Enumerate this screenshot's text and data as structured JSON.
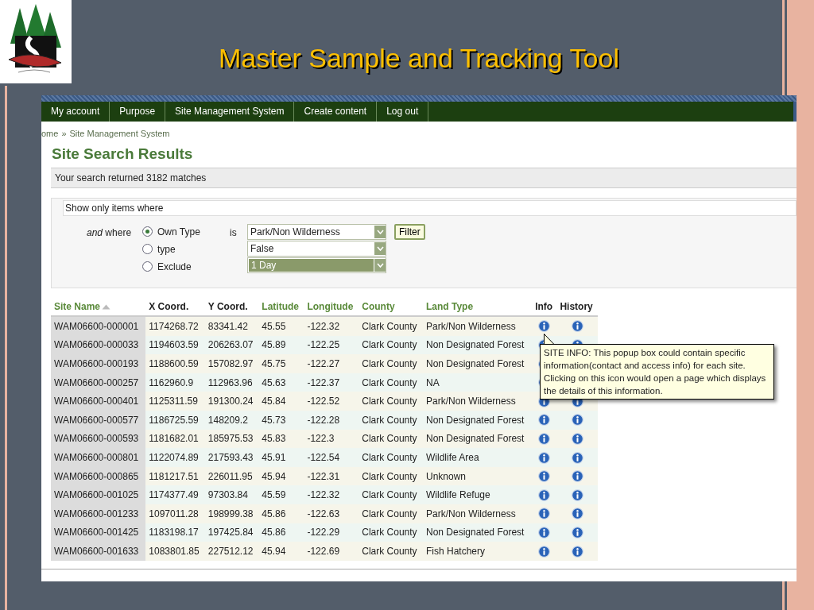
{
  "slide": {
    "title": "Master Sample and Tracking Tool"
  },
  "nav": [
    {
      "label": "My account"
    },
    {
      "label": "Purpose"
    },
    {
      "label": "Site Management System"
    },
    {
      "label": "Create content"
    },
    {
      "label": "Log out"
    }
  ],
  "breadcrumb": {
    "home": "ome",
    "separator": "»",
    "current": "Site Management System"
  },
  "page_title": "Site Search Results",
  "result_summary": "Your search returned 3182 matches",
  "filter": {
    "legend": "Show only items where",
    "lead_em": "and",
    "lead": "where",
    "is_label": "is",
    "button": "Filter",
    "options": [
      {
        "label": "Own Type",
        "selected": true
      },
      {
        "label": "type",
        "selected": false
      },
      {
        "label": "Exclude",
        "selected": false
      }
    ],
    "selects": [
      {
        "value": "Park/Non Wilderness",
        "highlighted": false
      },
      {
        "value": "False",
        "highlighted": false
      },
      {
        "value": "1 Day",
        "highlighted": true
      }
    ]
  },
  "table": {
    "columns": [
      {
        "label": "Site Name",
        "sortable": true,
        "sorted": true
      },
      {
        "label": "X Coord.",
        "sortable": false,
        "sorted": false
      },
      {
        "label": "Y Coord.",
        "sortable": false,
        "sorted": false
      },
      {
        "label": "Latitude",
        "sortable": true,
        "sorted": false
      },
      {
        "label": "Longitude",
        "sortable": true,
        "sorted": false
      },
      {
        "label": "County",
        "sortable": true,
        "sorted": false
      },
      {
        "label": "Land Type",
        "sortable": true,
        "sorted": false
      },
      {
        "label": "Info",
        "sortable": false,
        "sorted": false
      },
      {
        "label": "History",
        "sortable": false,
        "sorted": false
      }
    ],
    "rows": [
      [
        "WAM06600-000001",
        "1174268.72",
        "83341.42",
        "45.55",
        "-122.32",
        "Clark County",
        "Park/Non Wilderness"
      ],
      [
        "WAM06600-000033",
        "1194603.59",
        "206263.07",
        "45.89",
        "-122.25",
        "Clark County",
        "Non Designated Forest"
      ],
      [
        "WAM06600-000193",
        "1188600.59",
        "157082.97",
        "45.75",
        "-122.27",
        "Clark County",
        "Non Designated Forest"
      ],
      [
        "WAM06600-000257",
        "1162960.9",
        "112963.96",
        "45.63",
        "-122.37",
        "Clark County",
        "NA"
      ],
      [
        "WAM06600-000401",
        "1125311.59",
        "191300.24",
        "45.84",
        "-122.52",
        "Clark County",
        "Park/Non Wilderness"
      ],
      [
        "WAM06600-000577",
        "1186725.59",
        "148209.2",
        "45.73",
        "-122.28",
        "Clark County",
        "Non Designated Forest"
      ],
      [
        "WAM06600-000593",
        "1181682.01",
        "185975.53",
        "45.83",
        "-122.3",
        "Clark County",
        "Non Designated Forest"
      ],
      [
        "WAM06600-000801",
        "1122074.89",
        "217593.43",
        "45.91",
        "-122.54",
        "Clark County",
        "Wildlife Area"
      ],
      [
        "WAM06600-000865",
        "1181217.51",
        "226011.95",
        "45.94",
        "-122.31",
        "Clark County",
        "Unknown"
      ],
      [
        "WAM06600-001025",
        "1174377.49",
        "97303.84",
        "45.59",
        "-122.32",
        "Clark County",
        "Wildlife Refuge"
      ],
      [
        "WAM06600-001233",
        "1097011.28",
        "198999.38",
        "45.86",
        "-122.63",
        "Clark County",
        "Park/Non Wilderness"
      ],
      [
        "WAM06600-001425",
        "1183198.17",
        "197425.84",
        "45.86",
        "-122.29",
        "Clark County",
        "Non Designated Forest"
      ],
      [
        "WAM06600-001633",
        "1083801.85",
        "227512.12",
        "45.94",
        "-122.69",
        "Clark County",
        "Fish Hatchery"
      ]
    ]
  },
  "popup": {
    "text": "SITE INFO: This popup box could contain specific information(contact and access info) for each site. Clicking on this icon would open a page which displays the details of this information."
  }
}
